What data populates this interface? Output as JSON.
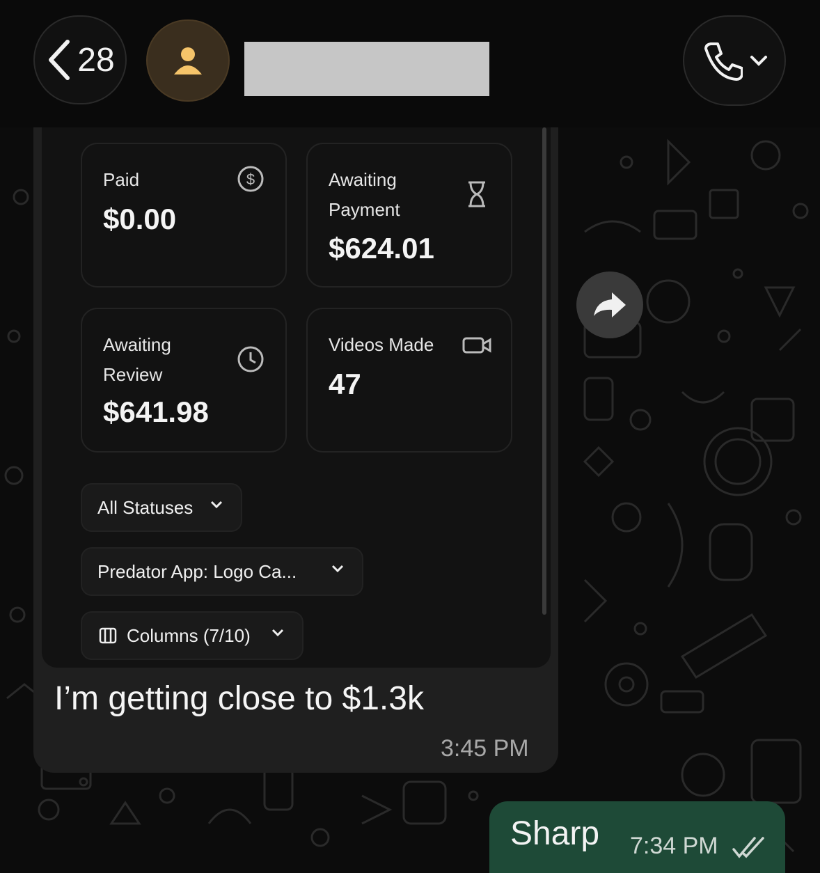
{
  "header": {
    "back_count": "28",
    "contact_name_redacted": true
  },
  "incoming_message": {
    "screenshot": {
      "cards": {
        "paid": {
          "label": "Paid",
          "value": "$0.00",
          "icon": "dollar-circle-icon"
        },
        "awaiting_payment": {
          "label_line1": "Awaiting",
          "label_line2": "Payment",
          "value": "$624.01",
          "icon": "hourglass-icon"
        },
        "awaiting_review": {
          "label_line1": "Awaiting",
          "label_line2": "Review",
          "value": "$641.98",
          "icon": "clock-icon"
        },
        "videos_made": {
          "label": "Videos Made",
          "value": "47",
          "icon": "video-camera-icon"
        }
      },
      "filters": {
        "status": "All Statuses",
        "campaign": "Predator App: Logo Ca...",
        "columns": "Columns (7/10)"
      }
    },
    "text": "I’m getting close to $1.3k",
    "time": "3:45 PM"
  },
  "outgoing_message": {
    "text": "Sharp",
    "time": "7:34 PM",
    "status": "read"
  },
  "colors": {
    "outgoing_bubble": "#1e4a37",
    "incoming_bubble": "#1f1f1f",
    "background": "#0b0b0b"
  }
}
